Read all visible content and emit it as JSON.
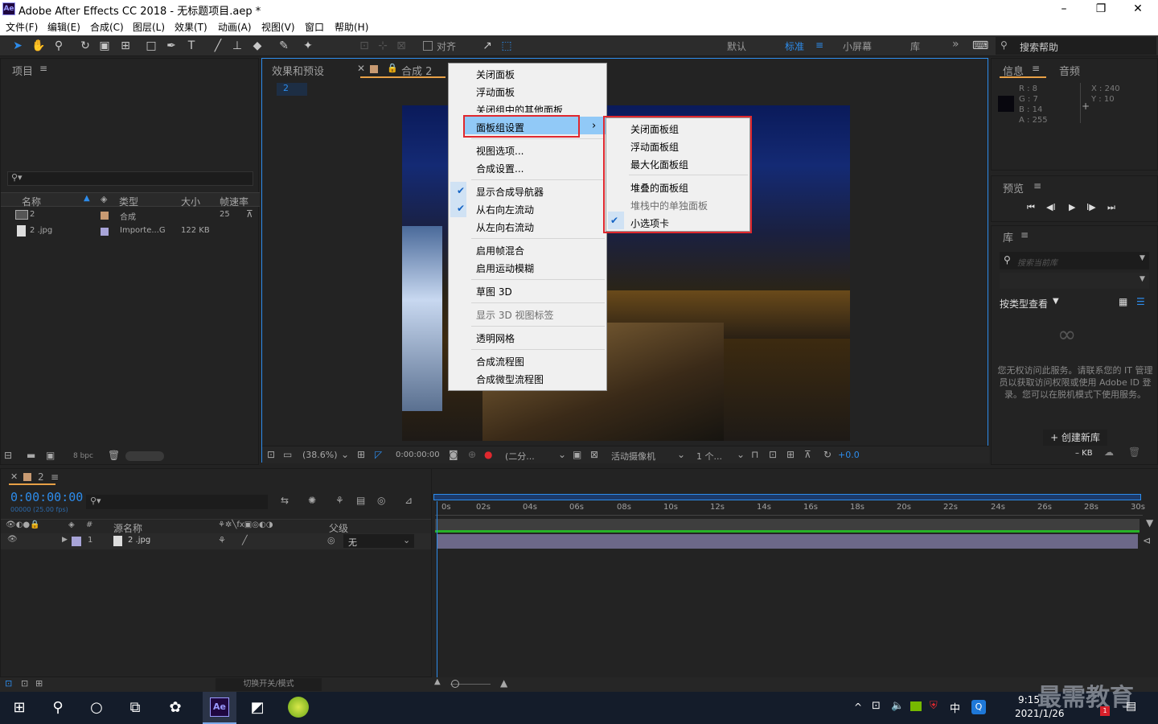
{
  "titlebar": {
    "logo": "Ae",
    "title": "Adobe After Effects CC 2018 - 无标题项目.aep *",
    "minimize": "–",
    "maximize": "❐",
    "close": "✕"
  },
  "menu": [
    "文件(F)",
    "编辑(E)",
    "合成(C)",
    "图层(L)",
    "效果(T)",
    "动画(A)",
    "视图(V)",
    "窗口",
    "帮助(H)"
  ],
  "toolbar": {
    "align": "对齐",
    "workspaces": [
      "默认",
      "标准",
      "小屏幕",
      "库"
    ],
    "more": "»",
    "search_placeholder": "搜索帮助"
  },
  "project": {
    "title": "项目",
    "columns": [
      "名称",
      "类型",
      "大小",
      "帧速率"
    ],
    "rows": [
      {
        "name": "2",
        "type": "合成",
        "size": "",
        "fps": "25"
      },
      {
        "name": "2 .jpg",
        "type": "Importe...G",
        "size": "122 KB",
        "fps": ""
      }
    ],
    "bpc": "8 bpc"
  },
  "effects_tab": "效果和预设",
  "comp_tab": "合成 2",
  "comp_chip": "2",
  "viewer": {
    "zoom": "(38.6%)",
    "time": "0:00:00:00",
    "resolution": "(二分...",
    "camera": "活动摄像机",
    "views": "1 个...",
    "exposure": "+0.0"
  },
  "context_menu": {
    "items": [
      {
        "label": "关闭面板",
        "checked": false,
        "disabled": false
      },
      {
        "label": "浮动面板",
        "checked": false,
        "disabled": false
      },
      {
        "label": "关闭组中的其他面板",
        "checked": false,
        "disabled": false
      },
      {
        "label": "面板组设置",
        "checked": false,
        "disabled": false,
        "submenu": true
      },
      {
        "label": "视图选项...",
        "checked": false,
        "disabled": false
      },
      {
        "label": "合成设置...",
        "checked": false,
        "disabled": false
      },
      {
        "label": "显示合成导航器",
        "checked": true,
        "disabled": false
      },
      {
        "label": "从右向左流动",
        "checked": true,
        "disabled": false
      },
      {
        "label": "从左向右流动",
        "checked": false,
        "disabled": false
      },
      {
        "label": "启用帧混合",
        "checked": false,
        "disabled": false
      },
      {
        "label": "启用运动模糊",
        "checked": false,
        "disabled": false
      },
      {
        "label": "草图 3D",
        "checked": false,
        "disabled": false
      },
      {
        "label": "显示 3D 视图标签",
        "checked": false,
        "disabled": true
      },
      {
        "label": "透明网格",
        "checked": false,
        "disabled": false
      },
      {
        "label": "合成流程图",
        "checked": false,
        "disabled": false
      },
      {
        "label": "合成微型流程图",
        "checked": false,
        "disabled": false
      }
    ],
    "arrow": "›"
  },
  "submenu": {
    "items": [
      {
        "label": "关闭面板组",
        "checked": false,
        "disabled": false
      },
      {
        "label": "浮动面板组",
        "checked": false,
        "disabled": false
      },
      {
        "label": "最大化面板组",
        "checked": false,
        "disabled": false
      },
      {
        "label": "堆叠的面板组",
        "checked": false,
        "disabled": false
      },
      {
        "label": "堆栈中的单独面板",
        "checked": false,
        "disabled": true
      },
      {
        "label": "小选项卡",
        "checked": true,
        "disabled": false
      }
    ]
  },
  "info": {
    "tabs": [
      "信息",
      "音频"
    ],
    "r": "R : 8",
    "g": "G : 7",
    "b": "B : 14",
    "a": "A :  255",
    "x": "X : 240",
    "y": "Y : 10"
  },
  "preview": {
    "title": "预览",
    "controls": [
      "⏮",
      "◀I",
      "▶",
      "I▶",
      "⏭"
    ]
  },
  "library": {
    "title": "库",
    "search_placeholder": "搜索当前库",
    "view_by": "按类型查看",
    "message": "您无权访问此服务。请联系您的 IT 管理员以获取访问权限或使用 Adobe ID 登录。您可以在脱机模式下使用服务。",
    "create": "+ 创建新库",
    "size": "– KB"
  },
  "timeline": {
    "tab": "2",
    "timecode": "0:00:00:00",
    "sub": "00000 (25.00 fps)",
    "col_source": "源名称",
    "col_parent": "父级",
    "layer_num": "1",
    "layer_name": "2 .jpg",
    "parent": "无",
    "ticks": [
      "0s",
      "02s",
      "04s",
      "06s",
      "08s",
      "10s",
      "12s",
      "14s",
      "16s",
      "18s",
      "20s",
      "22s",
      "24s",
      "26s",
      "28s",
      "30s"
    ],
    "toggle": "切换开关/模式"
  },
  "taskbar": {
    "time": "9:15",
    "date": "2021/1/26",
    "ime": "中",
    "watermark": "最需教育"
  },
  "colors": {
    "accent": "#2d8ceb",
    "highlight_red": "#e0282e",
    "timecode": "#2d8ceb"
  }
}
